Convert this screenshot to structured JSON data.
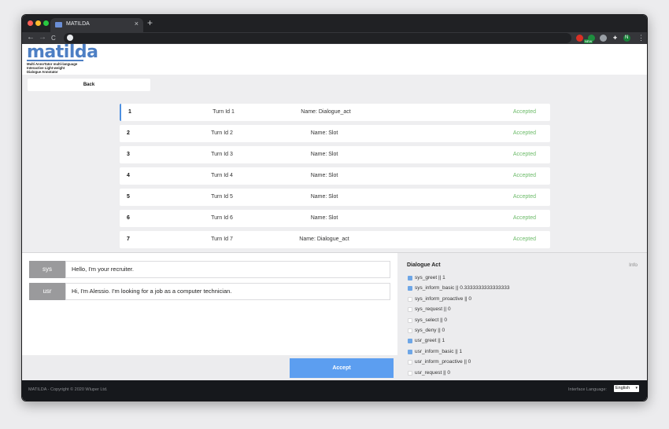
{
  "browser": {
    "tab_title": "MATILDA",
    "tab_close": "×",
    "new_tab": "+",
    "back": "←",
    "forward": "→",
    "reload": "C",
    "menu": "⋮",
    "extensions": [
      {
        "name": "extension-red-icon",
        "color": "#d93025",
        "label": ""
      },
      {
        "name": "extension-new-icon",
        "color": "#1e8e3e",
        "label": ""
      },
      {
        "name": "extension-grey-icon",
        "color": "#9aa0a6",
        "label": ""
      },
      {
        "name": "puzzle-icon",
        "color": "#35363a",
        "label": "✚"
      },
      {
        "name": "profile-avatar-icon",
        "color": "#188038",
        "label": "N"
      }
    ],
    "badge_new": "NEW"
  },
  "header": {
    "logo_word": "matilda",
    "logo_lines": [
      "Multi AnnoTator multi-language",
      "Interactive Light-weight",
      "Dialogue Annotator"
    ]
  },
  "back_button": "Back",
  "turns": [
    {
      "num": "1",
      "turn_id": "Turn Id 1",
      "name": "Name: Dialogue_act",
      "status": "Accepted"
    },
    {
      "num": "2",
      "turn_id": "Turn Id 2",
      "name": "Name: Slot",
      "status": "Accepted"
    },
    {
      "num": "3",
      "turn_id": "Turn Id 3",
      "name": "Name: Slot",
      "status": "Accepted"
    },
    {
      "num": "4",
      "turn_id": "Turn Id 4",
      "name": "Name: Slot",
      "status": "Accepted"
    },
    {
      "num": "5",
      "turn_id": "Turn Id 5",
      "name": "Name: Slot",
      "status": "Accepted"
    },
    {
      "num": "6",
      "turn_id": "Turn Id 6",
      "name": "Name: Slot",
      "status": "Accepted"
    },
    {
      "num": "7",
      "turn_id": "Turn Id 7",
      "name": "Name: Dialogue_act",
      "status": "Accepted"
    }
  ],
  "dialogue": [
    {
      "speaker": "sys",
      "text": "Hello, I'm your recruiter."
    },
    {
      "speaker": "usr",
      "text": "Hi, I'm Alessio. I'm looking for a job as a computer technician."
    }
  ],
  "accept_button": "Accept",
  "annotation": {
    "title": "Dialogue Act",
    "info": "Info",
    "acts": [
      {
        "label": "sys_greet || 1",
        "checked": true
      },
      {
        "label": "sys_inform_basic || 0.3333333333333333",
        "checked": true
      },
      {
        "label": "sys_inform_proactive || 0",
        "checked": false
      },
      {
        "label": "sys_request || 0",
        "checked": false
      },
      {
        "label": "sys_select || 0",
        "checked": false
      },
      {
        "label": "sys_deny || 0",
        "checked": false
      },
      {
        "label": "usr_greet || 1",
        "checked": true
      },
      {
        "label": "usr_inform_basic || 1",
        "checked": true
      },
      {
        "label": "usr_inform_proactive || 0",
        "checked": false
      },
      {
        "label": "usr_request || 0",
        "checked": false
      },
      {
        "label": "usr_select || 0",
        "checked": false
      }
    ]
  },
  "footer": {
    "copyright": "MATILDA - Copyright © 2020 Wluper Ltd.",
    "language_label": "Interface Language:",
    "language_value": "English",
    "language_caret": "▾"
  },
  "colors": {
    "accent": "#4d8fe0",
    "accept_button": "#5c9ef0",
    "accepted_status": "#6dbb6a",
    "speaker_tag": "#9a9a9c"
  }
}
